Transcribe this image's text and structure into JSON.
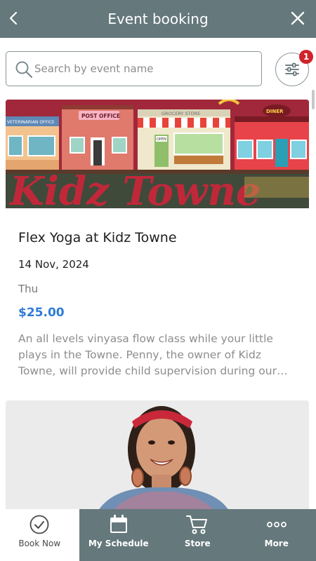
{
  "header": {
    "title": "Event booking",
    "back_icon": "chevron-left-icon",
    "close_icon": "close-icon"
  },
  "search": {
    "placeholder": "Search by event name",
    "icon": "search-icon"
  },
  "filter": {
    "icon": "sliders-icon",
    "badge_count": "1"
  },
  "events": [
    {
      "image_text": {
        "vet": "VETERINARIAN OFFICE",
        "post": "POST OFFICE",
        "grocery": "GROCERY STORE",
        "diner": "DINER",
        "open": "OPEN",
        "mural": "Kidz Towne"
      },
      "title": "Flex Yoga at Kidz Towne",
      "date": "14 Nov, 2024",
      "day": "Thu",
      "price": "$25.00",
      "description": "An all levels vinyasa flow class while your little plays in the Towne. Penny, the owner of Kidz Towne, will provide child supervision during our…"
    },
    {
      "image": "instructor-photo"
    }
  ],
  "nav": [
    {
      "label": "Book Now",
      "icon": "check-circle-icon"
    },
    {
      "label": "My Schedule",
      "icon": "calendar-icon"
    },
    {
      "label": "Store",
      "icon": "cart-icon"
    },
    {
      "label": "More",
      "icon": "more-dots-icon"
    }
  ],
  "colors": {
    "header_bg": "#65787c",
    "price": "#2f7cd6",
    "badge": "#d0232b",
    "nav_bg": "#65787c"
  }
}
